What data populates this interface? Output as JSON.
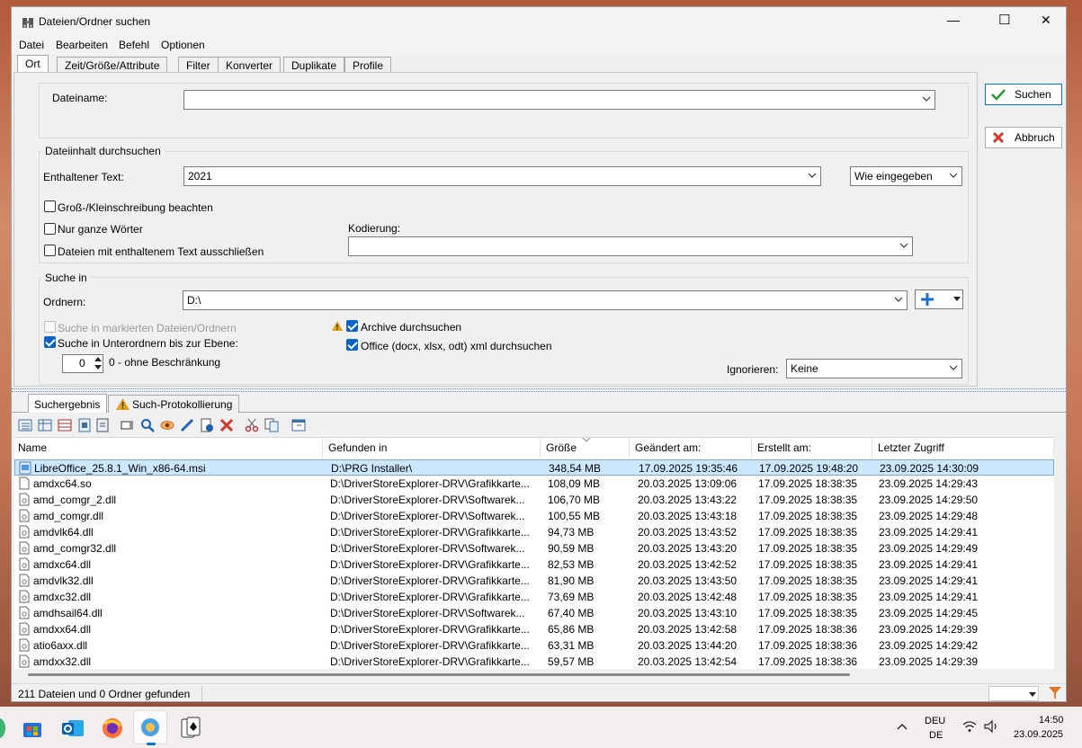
{
  "window": {
    "title": "Dateien/Ordner suchen",
    "controls": {
      "minimize": "—",
      "maximize": "☐",
      "close": "✕"
    }
  },
  "menu": [
    "Datei",
    "Bearbeiten",
    "Befehl",
    "Optionen"
  ],
  "top_tabs": [
    "Ort",
    "Zeit/Größe/Attribute",
    "Filter",
    "Konverter",
    "Duplikate",
    "Profile"
  ],
  "active_top_tab": "Ort",
  "filename": {
    "label": "Dateiname:",
    "value": ""
  },
  "content_group": {
    "title": "Dateiinhalt durchsuchen",
    "text_label": "Enthaltener Text:",
    "text_value": "2021",
    "mode_value": "Wie eingegeben",
    "case_label": "Groß-/Kleinschreibung beachten",
    "whole_words_label": "Nur ganze Wörter",
    "exclude_label": "Dateien mit enthaltenem Text ausschließen",
    "encoding_label": "Kodierung:",
    "encoding_value": "",
    "case_checked": false,
    "whole_words_checked": false,
    "exclude_checked": false
  },
  "search_in": {
    "title": "Suche in",
    "folders_label": "Ordnern:",
    "folders_value": "D:\\",
    "marked_label": "Suche in markierten Dateien/Ordnern",
    "marked_checked": false,
    "subfolders_label": "Suche in Unterordnern bis zur Ebene:",
    "subfolders_checked": true,
    "level_value": "0",
    "level_hint": "0 - ohne Beschränkung",
    "archive_label": "Archive durchsuchen",
    "archive_checked": true,
    "office_label": "Office (docx, xlsx, odt) xml durchsuchen",
    "office_checked": true,
    "ignore_label": "Ignorieren:",
    "ignore_value": "Keine"
  },
  "buttons": {
    "search": "Suchen",
    "cancel": "Abbruch"
  },
  "result_tabs": [
    "Suchergebnis",
    "Such-Protokollierung"
  ],
  "columns": [
    "Name",
    "Gefunden in",
    "Größe",
    "Geändert am:",
    "Erstellt am:",
    "Letzter Zugriff"
  ],
  "rows": [
    {
      "name": "LibreOffice_25.8.1_Win_x86-64.msi",
      "path": "D:\\PRG Installer\\",
      "size": "348,54 MB",
      "modified": "17.09.2025 19:35:46",
      "created": "17.09.2025 19:48:20",
      "accessed": "23.09.2025 14:30:09"
    },
    {
      "name": "amdxc64.so",
      "path": "D:\\DriverStoreExplorer-DRV\\Grafikkarte...",
      "size": "108,09 MB",
      "modified": "20.03.2025 13:09:06",
      "created": "17.09.2025 18:38:35",
      "accessed": "23.09.2025 14:29:43"
    },
    {
      "name": "amd_comgr_2.dll",
      "path": "D:\\DriverStoreExplorer-DRV\\Softwarek...",
      "size": "106,70 MB",
      "modified": "20.03.2025 13:43:22",
      "created": "17.09.2025 18:38:35",
      "accessed": "23.09.2025 14:29:50"
    },
    {
      "name": "amd_comgr.dll",
      "path": "D:\\DriverStoreExplorer-DRV\\Softwarek...",
      "size": "100,55 MB",
      "modified": "20.03.2025 13:43:18",
      "created": "17.09.2025 18:38:35",
      "accessed": "23.09.2025 14:29:48"
    },
    {
      "name": "amdvlk64.dll",
      "path": "D:\\DriverStoreExplorer-DRV\\Grafikkarte...",
      "size": "94,73 MB",
      "modified": "20.03.2025 13:43:52",
      "created": "17.09.2025 18:38:35",
      "accessed": "23.09.2025 14:29:41"
    },
    {
      "name": "amd_comgr32.dll",
      "path": "D:\\DriverStoreExplorer-DRV\\Softwarek...",
      "size": "90,59 MB",
      "modified": "20.03.2025 13:43:20",
      "created": "17.09.2025 18:38:35",
      "accessed": "23.09.2025 14:29:49"
    },
    {
      "name": "amdxc64.dll",
      "path": "D:\\DriverStoreExplorer-DRV\\Grafikkarte...",
      "size": "82,53 MB",
      "modified": "20.03.2025 13:42:52",
      "created": "17.09.2025 18:38:35",
      "accessed": "23.09.2025 14:29:41"
    },
    {
      "name": "amdvlk32.dll",
      "path": "D:\\DriverStoreExplorer-DRV\\Grafikkarte...",
      "size": "81,90 MB",
      "modified": "20.03.2025 13:43:50",
      "created": "17.09.2025 18:38:35",
      "accessed": "23.09.2025 14:29:41"
    },
    {
      "name": "amdxc32.dll",
      "path": "D:\\DriverStoreExplorer-DRV\\Grafikkarte...",
      "size": "73,69 MB",
      "modified": "20.03.2025 13:42:48",
      "created": "17.09.2025 18:38:35",
      "accessed": "23.09.2025 14:29:41"
    },
    {
      "name": "amdhsail64.dll",
      "path": "D:\\DriverStoreExplorer-DRV\\Softwarek...",
      "size": "67,40 MB",
      "modified": "20.03.2025 13:43:10",
      "created": "17.09.2025 18:38:35",
      "accessed": "23.09.2025 14:29:45"
    },
    {
      "name": "amdxx64.dll",
      "path": "D:\\DriverStoreExplorer-DRV\\Grafikkarte...",
      "size": "65,86 MB",
      "modified": "20.03.2025 13:42:58",
      "created": "17.09.2025 18:38:36",
      "accessed": "23.09.2025 14:29:39"
    },
    {
      "name": "atio6axx.dll",
      "path": "D:\\DriverStoreExplorer-DRV\\Grafikkarte...",
      "size": "63,31 MB",
      "modified": "20.03.2025 13:44:20",
      "created": "17.09.2025 18:38:36",
      "accessed": "23.09.2025 14:29:42"
    },
    {
      "name": "amdxx32.dll",
      "path": "D:\\DriverStoreExplorer-DRV\\Grafikkarte...",
      "size": "59,57 MB",
      "modified": "20.03.2025 13:42:54",
      "created": "17.09.2025 18:38:36",
      "accessed": "23.09.2025 14:29:39"
    }
  ],
  "status": "211 Dateien und 0 Ordner gefunden",
  "taskbar": {
    "lang_top": "DEU",
    "lang_bottom": "DE",
    "time": "14:50",
    "date": "23.09.2025"
  },
  "colors": {
    "accent": "#0078d7",
    "selection": "#cce8ff",
    "check": "#0a64c8"
  }
}
